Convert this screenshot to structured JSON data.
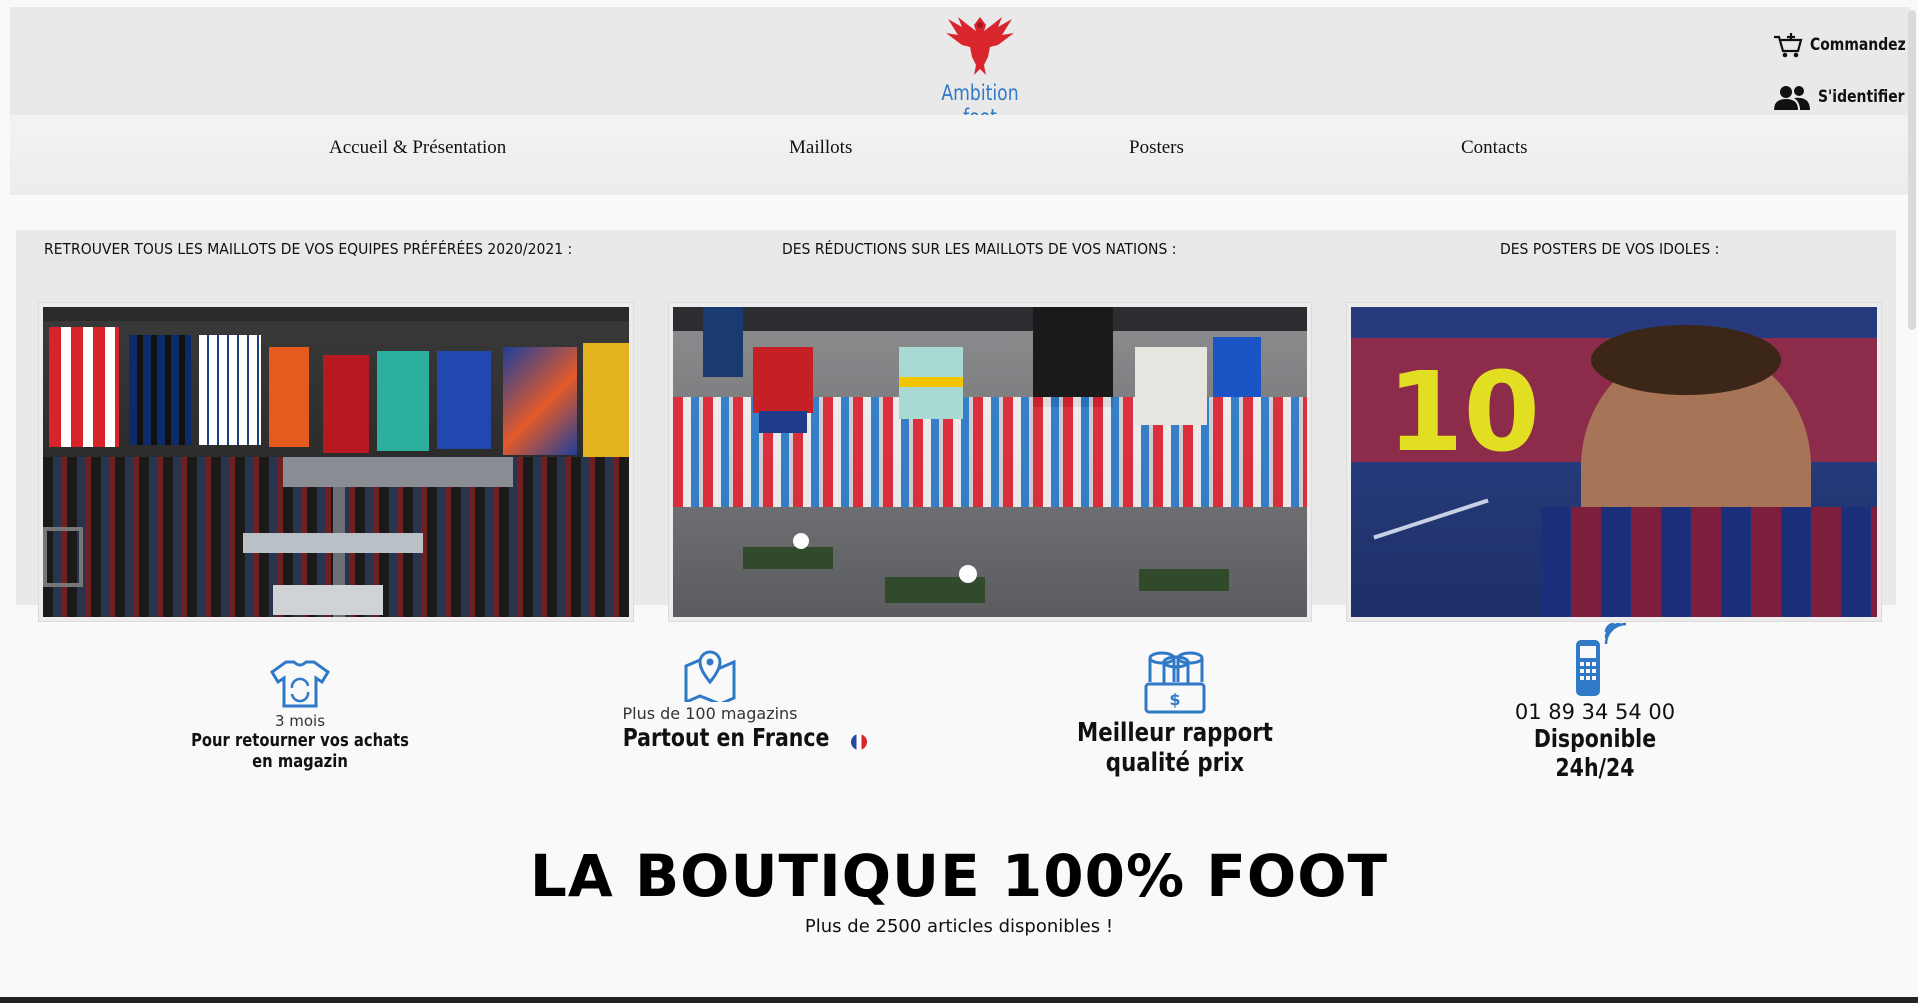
{
  "header": {
    "brand": "Ambition foot",
    "cart_label": "Commandez",
    "login_label": "S'identifier"
  },
  "nav": {
    "items": [
      {
        "label": "Accueil & Présentation"
      },
      {
        "label": "Maillots"
      },
      {
        "label": "Posters"
      },
      {
        "label": "Contacts"
      }
    ]
  },
  "promo": {
    "titles": [
      "RETROUVER TOUS LES MAILLOTS DE VOS EQUIPES PRÉFÉRÉES 2020/2021 :",
      "DES RÉDUCTIONS SUR LES MAILLOTS DE VOS NATIONS :",
      "DES POSTERS DE VOS IDOLES :"
    ],
    "poster_number": "10"
  },
  "features": {
    "returns": {
      "line1": "3 mois",
      "line2": "Pour retourner vos achats en magazin",
      "icon": "tshirt-return-icon"
    },
    "stores": {
      "line1": "Plus de 100 magazins",
      "line2": "Partout en France",
      "icon": "map-pin-icon"
    },
    "value": {
      "line2": "Meilleur rapport qualité prix",
      "icon": "money-stack-icon"
    },
    "phone": {
      "line1": "01 89 34 54 00",
      "line2": "Disponible 24h/24",
      "icon": "phone-icon"
    }
  },
  "hero": {
    "title": "LA BOUTIQUE 100% FOOT",
    "subtitle": "Plus de 2500 articles disponibles !"
  },
  "colors": {
    "accent_blue": "#2f79c6",
    "logo_red": "#d9262c",
    "header_bg": "#e9e9e9"
  }
}
